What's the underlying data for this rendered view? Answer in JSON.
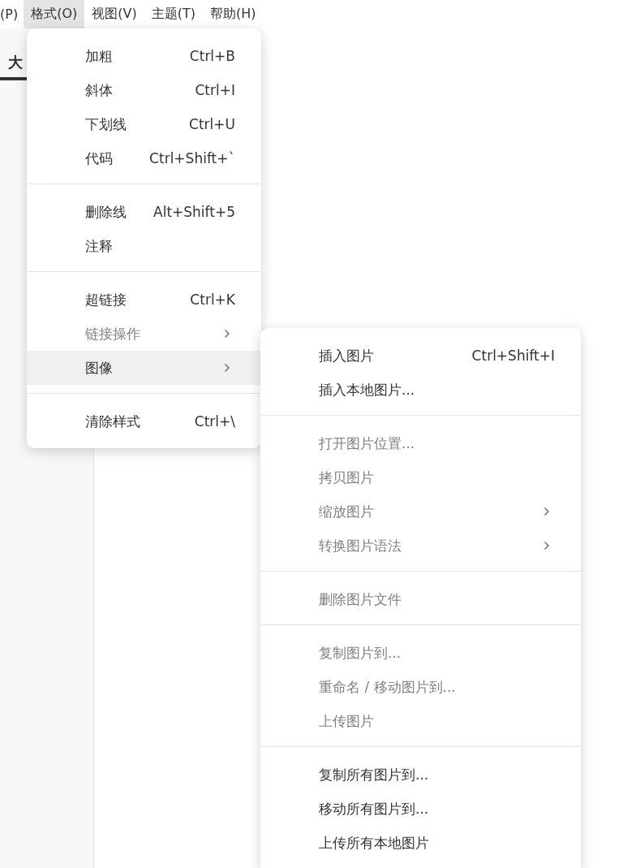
{
  "menu_bar": [
    {
      "label": "(P)",
      "selected": false
    },
    {
      "label": "格式(O)",
      "selected": true
    },
    {
      "label": "视图(V)",
      "selected": false
    },
    {
      "label": "主题(T)",
      "selected": false
    },
    {
      "label": "帮助(H)",
      "selected": false
    }
  ],
  "sidebar": {
    "tab": {
      "label": "大",
      "selected": true
    }
  },
  "format_menu": {
    "sections": [
      [
        {
          "label": "加粗",
          "shortcut": "Ctrl+B",
          "disabled": false,
          "submenu": false,
          "selected": false
        },
        {
          "label": "斜体",
          "shortcut": "Ctrl+I",
          "disabled": false,
          "submenu": false,
          "selected": false
        },
        {
          "label": "下划线",
          "shortcut": "Ctrl+U",
          "disabled": false,
          "submenu": false,
          "selected": false
        },
        {
          "label": "代码",
          "shortcut": "Ctrl+Shift+`",
          "disabled": false,
          "submenu": false,
          "selected": false
        }
      ],
      [
        {
          "label": "删除线",
          "shortcut": "Alt+Shift+5",
          "disabled": false,
          "submenu": false,
          "selected": false
        },
        {
          "label": "注释",
          "disabled": false,
          "submenu": false,
          "selected": false
        }
      ],
      [
        {
          "label": "超链接",
          "shortcut": "Ctrl+K",
          "disabled": false,
          "submenu": false,
          "selected": false
        },
        {
          "label": "链接操作",
          "disabled": true,
          "submenu": true,
          "selected": false
        },
        {
          "label": "图像",
          "disabled": false,
          "submenu": true,
          "selected": true
        }
      ],
      [
        {
          "label": "清除样式",
          "shortcut": "Ctrl+\\",
          "disabled": false,
          "submenu": false,
          "selected": false
        }
      ]
    ]
  },
  "image_submenu": {
    "sections": [
      [
        {
          "label": "插入图片",
          "shortcut": "Ctrl+Shift+I",
          "disabled": false,
          "submenu": false,
          "selected": false
        },
        {
          "label": "插入本地图片...",
          "disabled": false,
          "submenu": false,
          "selected": false
        }
      ],
      [
        {
          "label": "打开图片位置...",
          "disabled": true,
          "submenu": false,
          "selected": false
        },
        {
          "label": "拷贝图片",
          "disabled": true,
          "submenu": false,
          "selected": false
        },
        {
          "label": "缩放图片",
          "disabled": true,
          "submenu": true,
          "selected": false
        },
        {
          "label": "转换图片语法",
          "disabled": true,
          "submenu": true,
          "selected": false
        }
      ],
      [
        {
          "label": "删除图片文件",
          "disabled": true,
          "submenu": false,
          "selected": false
        }
      ],
      [
        {
          "label": "复制图片到...",
          "disabled": true,
          "submenu": false,
          "selected": false
        },
        {
          "label": "重命名 / 移动图片到...",
          "disabled": true,
          "submenu": false,
          "selected": false
        },
        {
          "label": "上传图片",
          "disabled": true,
          "submenu": false,
          "selected": false
        }
      ],
      [
        {
          "label": "复制所有图片到...",
          "disabled": false,
          "submenu": false,
          "selected": false
        },
        {
          "label": "移动所有图片到...",
          "disabled": false,
          "submenu": false,
          "selected": false
        },
        {
          "label": "上传所有本地图片",
          "disabled": false,
          "submenu": false,
          "selected": false
        }
      ]
    ]
  }
}
